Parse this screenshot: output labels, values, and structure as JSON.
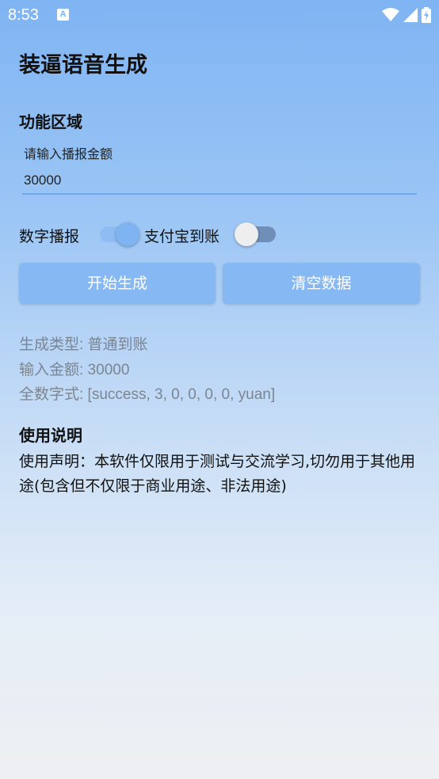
{
  "status_bar": {
    "time": "8:53",
    "notification_icon": "a-icon",
    "a_glyph": "A"
  },
  "app": {
    "title": "装逼语音生成"
  },
  "function_area": {
    "title": "功能区域",
    "input_label": "请输入播报金额",
    "input_value": "30000"
  },
  "switches": {
    "digital_broadcast": {
      "label": "数字播报",
      "on": true
    },
    "alipay_arrival": {
      "label": "支付宝到账",
      "on": false
    }
  },
  "buttons": {
    "start": "开始生成",
    "clear": "清空数据"
  },
  "info": {
    "type_line": "生成类型: 普通到账",
    "amount_line": "输入金额: 30000",
    "digits_line": "全数字式: [success, 3, 0, 0, 0, 0, yuan]"
  },
  "usage": {
    "title": "使用说明",
    "text": "使用声明：本软件仅限用于测试与交流学习,切勿用于其他用途(包含但不仅限于商业用途、非法用途)"
  },
  "colors": {
    "accent": "#86b9f3",
    "switch_on_thumb": "#7fb4f3",
    "switch_off_thumb": "#eeeeee"
  }
}
